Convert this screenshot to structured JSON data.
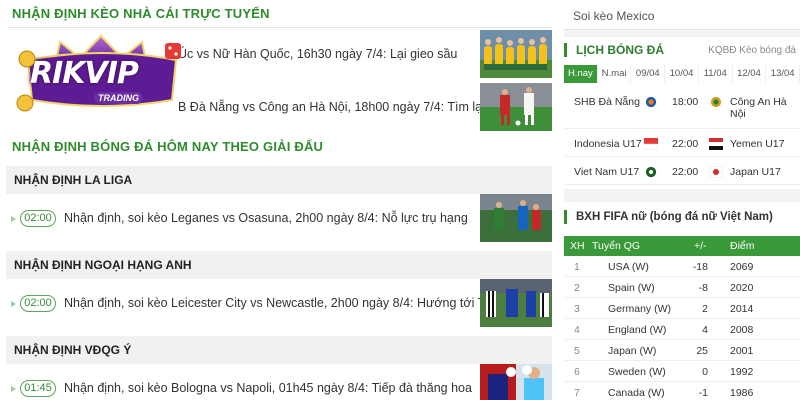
{
  "left": {
    "section1_title": "NHẬN ĐỊNH KÈO NHÀ CÁI TRỰC TUYẾN",
    "top_news": [
      {
        "title": "Úc vs Nữ Hàn Quốc, 16h30 ngày 7/4: Lại gieo sầu"
      },
      {
        "title": "B Đà Nẵng vs Công an Hà Nội, 18h00 ngày 7/4: Tìm lại"
      }
    ],
    "section2_title": "NHẬN ĐỊNH BÓNG ĐÁ HÔM NAY THEO GIẢI ĐẤU",
    "leagues": [
      {
        "name": "NHẬN ĐỊNH LA LIGA",
        "time": "02:00",
        "title": "Nhận định, soi kèo Leganes vs Osasuna, 2h00 ngày 8/4: Nỗ lực trụ hạng"
      },
      {
        "name": "NHẬN ĐỊNH NGOẠI HẠNG ANH",
        "time": "02:00",
        "title": "Nhận định, soi kèo Leicester City vs Newcastle, 2h00 ngày 8/4: Hướng tới Top 4"
      },
      {
        "name": "NHẬN ĐỊNH VĐQG Ý",
        "time": "01:45",
        "title": "Nhận định, soi kèo Bologna vs Napoli, 01h45 ngày 8/4: Tiếp đà thăng hoa"
      }
    ],
    "logo": {
      "text": "RIKVIP",
      "sub": "TRADING"
    }
  },
  "right": {
    "tag": "Soi kèo Mexico",
    "schedule": {
      "title": "LỊCH BÓNG ĐÁ",
      "links": "KQBĐ   Kèo bóng đá",
      "dates": [
        "H.nay",
        "N.mai",
        "09/04",
        "10/04",
        "11/04",
        "12/04",
        "13/04"
      ],
      "matches": [
        {
          "home": "SHB Đà Nẵng",
          "time": "18:00",
          "away": "Công An Hà Nội"
        },
        {
          "home": "Indonesia U17",
          "time": "22:00",
          "away": "Yemen U17"
        },
        {
          "home": "Viet Nam U17",
          "time": "22:00",
          "away": "Japan U17"
        }
      ]
    },
    "fifa": {
      "title": "BXH FIFA nữ (bóng đá nữ Việt Nam)",
      "headers": {
        "rank": "XH",
        "team": "Tuyển QG",
        "change": "+/-",
        "points": "Điểm"
      },
      "rows": [
        {
          "rank": "1",
          "team": "USA (W)",
          "change": "-18",
          "points": "2069"
        },
        {
          "rank": "2",
          "team": "Spain (W)",
          "change": "-8",
          "points": "2020"
        },
        {
          "rank": "3",
          "team": "Germany (W)",
          "change": "2",
          "points": "2014"
        },
        {
          "rank": "4",
          "team": "England (W)",
          "change": "4",
          "points": "2008"
        },
        {
          "rank": "5",
          "team": "Japan (W)",
          "change": "25",
          "points": "2001"
        },
        {
          "rank": "6",
          "team": "Sweden (W)",
          "change": "0",
          "points": "1992"
        },
        {
          "rank": "7",
          "team": "Canada (W)",
          "change": "-1",
          "points": "1986"
        }
      ]
    }
  }
}
